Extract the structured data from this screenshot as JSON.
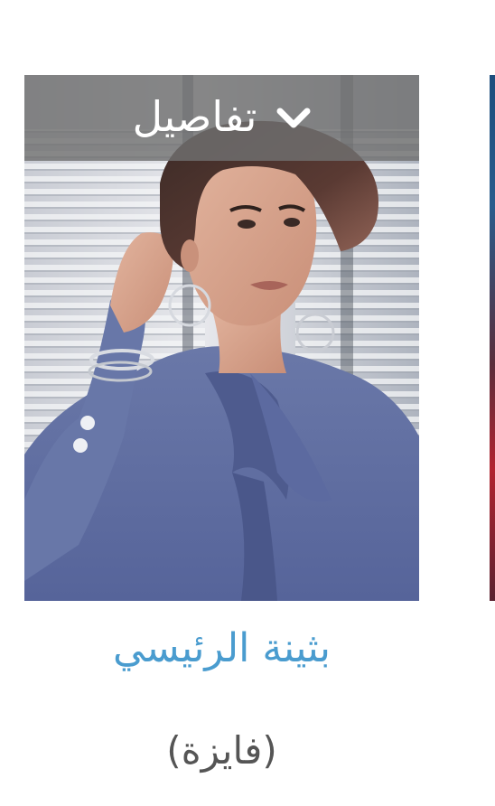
{
  "card": {
    "details_label": "تفاصيل",
    "toggle_icon": "chevron-down-icon",
    "name": "بثينة الرئيسي",
    "role": "(فايزة)"
  },
  "colors": {
    "name_link": "#4a9ccf",
    "role_text": "#555555",
    "details_bar": "#707070"
  }
}
